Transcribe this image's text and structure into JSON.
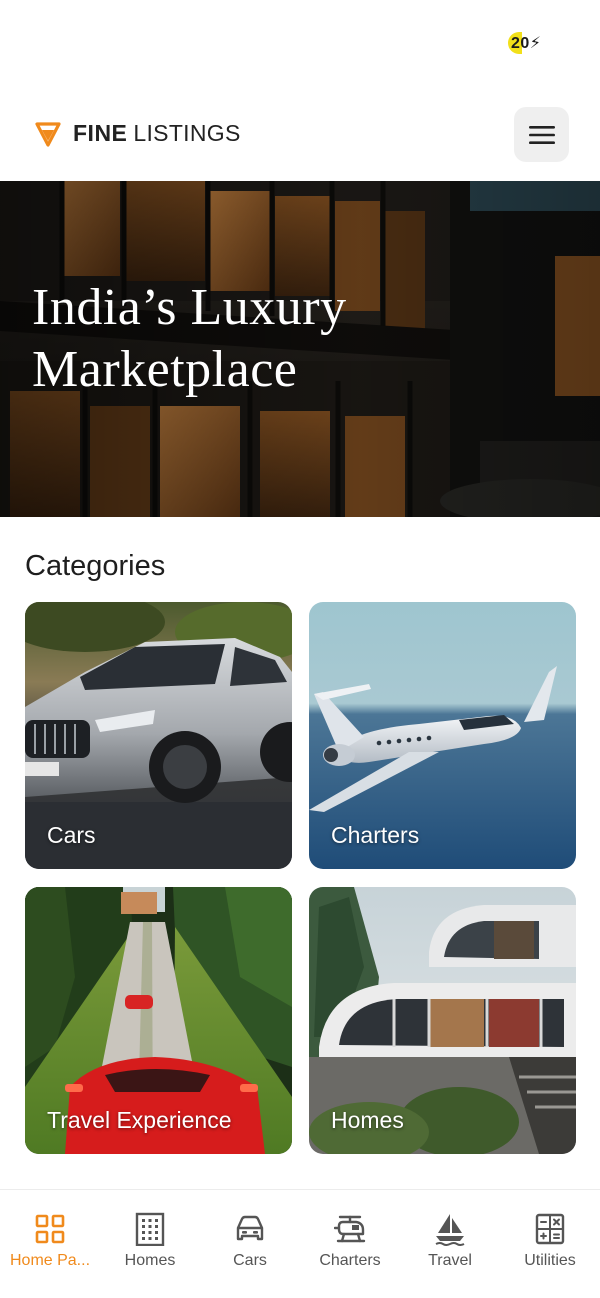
{
  "status_bar": {
    "battery": "20"
  },
  "header": {
    "logo_bold": "FINE",
    "logo_light": "LISTINGS",
    "menu_icon": "hamburger-menu-icon"
  },
  "hero": {
    "title_line1": "India’s Luxury",
    "title_line2": "Marketplace"
  },
  "categories": {
    "title": "Categories",
    "items": [
      {
        "label": "Cars"
      },
      {
        "label": "Charters"
      },
      {
        "label": "Travel Experience"
      },
      {
        "label": "Homes"
      }
    ]
  },
  "bottom_nav": {
    "active_color": "#f08a1c",
    "items": [
      {
        "label": "Home Pa...",
        "icon": "grid-icon",
        "active": true
      },
      {
        "label": "Homes",
        "icon": "building-icon",
        "active": false
      },
      {
        "label": "Cars",
        "icon": "car-icon",
        "active": false
      },
      {
        "label": "Charters",
        "icon": "helicopter-icon",
        "active": false
      },
      {
        "label": "Travel",
        "icon": "sailboat-icon",
        "active": false
      },
      {
        "label": "Utilities",
        "icon": "calculator-icon",
        "active": false
      }
    ]
  }
}
